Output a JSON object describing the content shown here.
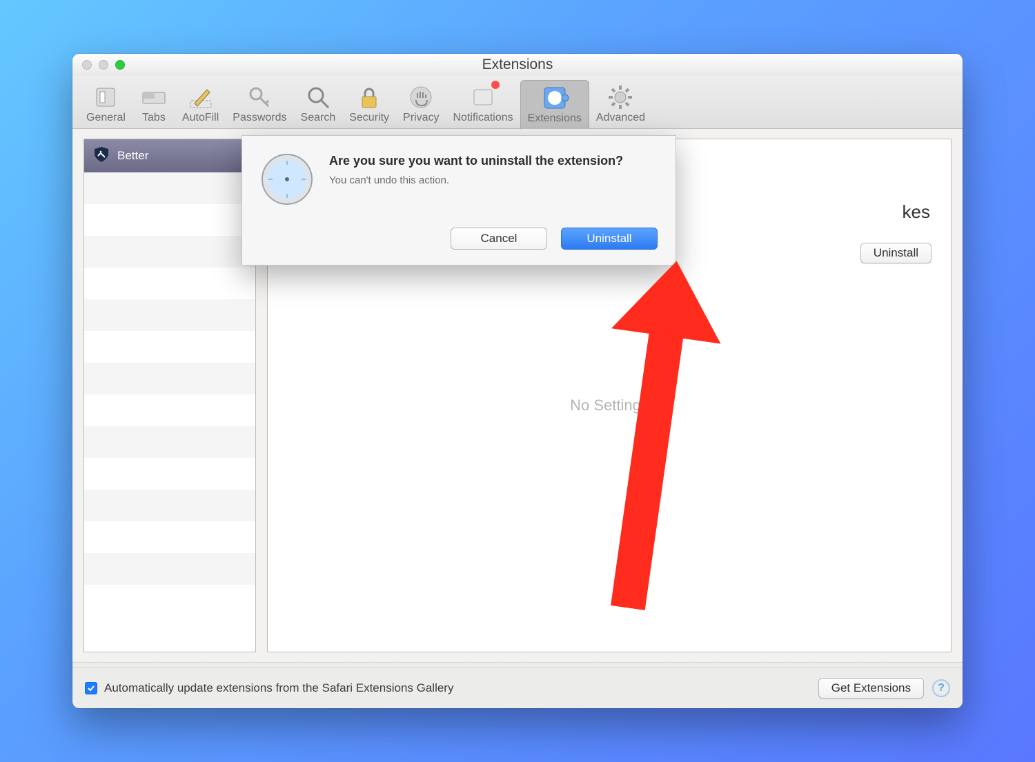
{
  "window": {
    "title": "Extensions"
  },
  "toolbar": [
    {
      "label": "General",
      "icon": "switch-icon"
    },
    {
      "label": "Tabs",
      "icon": "tabs-icon"
    },
    {
      "label": "AutoFill",
      "icon": "pencil-icon"
    },
    {
      "label": "Passwords",
      "icon": "key-icon"
    },
    {
      "label": "Search",
      "icon": "search-icon"
    },
    {
      "label": "Security",
      "icon": "lock-icon"
    },
    {
      "label": "Privacy",
      "icon": "hand-icon"
    },
    {
      "label": "Notifications",
      "icon": "notification-icon"
    },
    {
      "label": "Extensions",
      "icon": "compass-puzzle-icon"
    },
    {
      "label": "Advanced",
      "icon": "gear-icon"
    }
  ],
  "sidebar": {
    "selected": {
      "name": "Better",
      "icon": "shield-icon"
    }
  },
  "main": {
    "title": "",
    "subtitle_fragment": "kes",
    "uninstall_label": "Uninstall",
    "no_settings_label": "No Settings"
  },
  "footer": {
    "auto_update_checked": true,
    "auto_update_label": "Automatically update extensions from the Safari Extensions Gallery",
    "get_extensions_label": "Get Extensions",
    "help_label": "?"
  },
  "dialog": {
    "icon": "safari-compass-icon",
    "message": "Are you sure you want to uninstall the extension?",
    "subtext": "You can't undo this action.",
    "cancel_label": "Cancel",
    "confirm_label": "Uninstall"
  },
  "annotation": {
    "arrow_color": "#ff2b1c"
  }
}
